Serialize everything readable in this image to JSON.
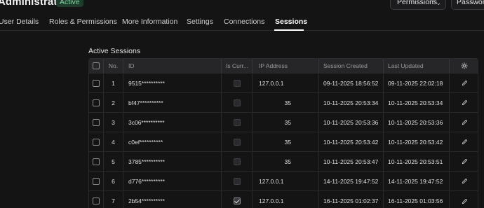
{
  "header": {
    "title": "Administrator",
    "status_badge": "Active",
    "permissions_select": "Permissions",
    "password_button": "Password"
  },
  "tabs": [
    {
      "label": "User Details"
    },
    {
      "label": "Roles & Permissions"
    },
    {
      "label": "More Information"
    },
    {
      "label": "Settings"
    },
    {
      "label": "Connections"
    },
    {
      "label": "Sessions",
      "active": true
    }
  ],
  "sessions": {
    "title": "Active Sessions",
    "columns": {
      "no": "No.",
      "id": "ID",
      "is_current": "Is Curr...",
      "ip": "IP Address",
      "created": "Session Created",
      "updated": "Last Updated"
    },
    "rows": [
      {
        "no": "1",
        "id": "9515**********",
        "is_current": false,
        "ip": "127.0.0.1",
        "created": "09-11-2025 18:56:52",
        "updated": "09-11-2025 22:02:18"
      },
      {
        "no": "2",
        "id": "bf47**********",
        "is_current": false,
        "ip": "35",
        "created": "10-11-2025 20:53:34",
        "updated": "10-11-2025 20:53:34"
      },
      {
        "no": "3",
        "id": "3c06**********",
        "is_current": false,
        "ip": "35",
        "created": "10-11-2025 20:53:36",
        "updated": "10-11-2025 20:53:36"
      },
      {
        "no": "4",
        "id": "c0ef**********",
        "is_current": false,
        "ip": "35",
        "created": "10-11-2025 20:53:42",
        "updated": "10-11-2025 20:53:42"
      },
      {
        "no": "5",
        "id": "3785**********",
        "is_current": false,
        "ip": "35",
        "created": "10-11-2025 20:53:47",
        "updated": "10-11-2025 20:53:51"
      },
      {
        "no": "6",
        "id": "d776**********",
        "is_current": false,
        "ip": "127.0.0.1",
        "created": "14-11-2025 19:47:52",
        "updated": "14-11-2025 19:47:52"
      },
      {
        "no": "7",
        "id": "2b54**********",
        "is_current": true,
        "ip": "127.0.0.1",
        "created": "16-11-2025 01:02:37",
        "updated": "16-11-2025 01:03:56"
      }
    ]
  }
}
